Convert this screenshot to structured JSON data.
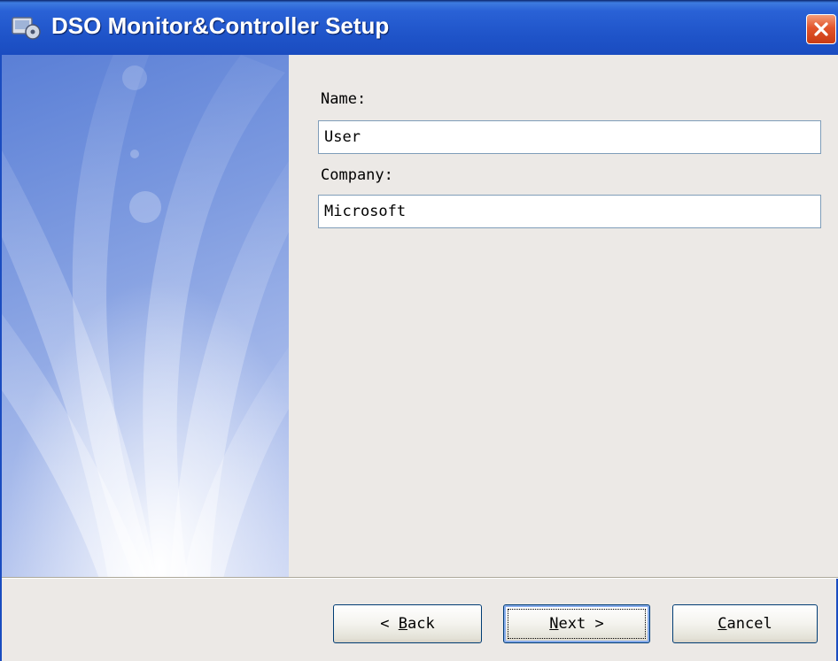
{
  "window": {
    "title": "DSO Monitor&Controller Setup",
    "icon": "setup-installer-icon"
  },
  "form": {
    "name_label": "Name:",
    "name_value": "User",
    "company_label": "Company:",
    "company_value": "Microsoft"
  },
  "buttons": {
    "back_prefix": "< ",
    "back_accel": "B",
    "back_rest": "ack",
    "next_accel": "N",
    "next_rest": "ext",
    "next_suffix": " >",
    "cancel_accel": "C",
    "cancel_rest": "ancel"
  },
  "colors": {
    "titlebar": "#2a62d6",
    "close": "#e2552c",
    "banner": "#7e9be0",
    "panel": "#ece9e6"
  }
}
